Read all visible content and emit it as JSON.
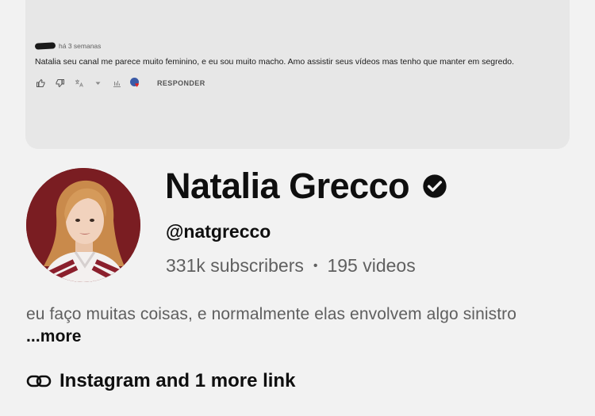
{
  "comment": {
    "time": "há 3 semanas",
    "text": "Natalia seu canal me parece muito feminino, e eu sou muito macho. Amo assistir seus vídeos mas tenho que manter em segredo.",
    "reply_label": "RESPONDER",
    "icons": [
      "thumbs-up-icon",
      "thumbs-down-icon",
      "translate-icon",
      "bar-chart-icon",
      "creator-heart-icon"
    ]
  },
  "channel": {
    "name": "Natalia Grecco",
    "handle": "@natgrecco",
    "subscribers": "331k subscribers",
    "separator": "•",
    "videos": "195 videos",
    "description": "eu faço muitas coisas, e normalmente elas envolvem algo sinistro",
    "more_label": "...more",
    "links_label": "Instagram and 1 more link"
  },
  "colors": {
    "background": "#f2f2f2",
    "card": "#e7e7e7",
    "text_primary": "#0f0f0f",
    "text_secondary": "#606060",
    "avatar_bg": "#7a1d22"
  }
}
